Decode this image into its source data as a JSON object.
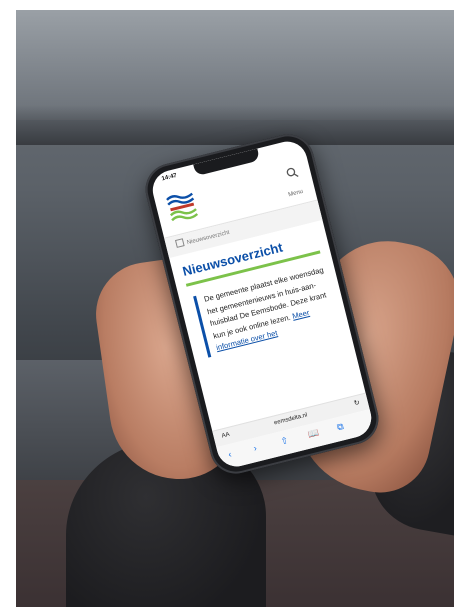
{
  "phone": {
    "status_time": "14:47",
    "site": {
      "menu_label": "Menu",
      "breadcrumb": "Nieuwsoverzicht",
      "page_title": "Nieuwsoverzicht",
      "intro_text": "De gemeente plaatst elke woensdag het gemeentenieuws in huis-aan-huisblad De Eemsbode. Deze krant kun je ook online lezen.",
      "more_link": "Meer informatie over het",
      "address_bar": {
        "aa": "AA",
        "url": "eemsdelta.nl",
        "reload": "↻"
      },
      "toolbar": {
        "back": "‹",
        "forward": "›",
        "share": "⇧",
        "bookmarks": "📖",
        "tabs": "⧉"
      }
    }
  },
  "colors": {
    "brand_blue": "#0b4fa8",
    "brand_green": "#7cc24a"
  }
}
